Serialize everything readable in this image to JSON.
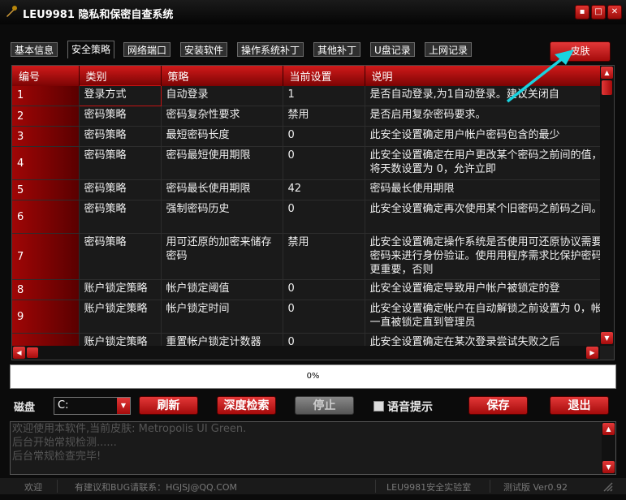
{
  "window": {
    "title": "LEU9981 隐私和保密自查系统",
    "min": "▪",
    "max": "□",
    "close": "✕"
  },
  "tabs": [
    "基本信息",
    "安全策略",
    "网络端口",
    "安装软件",
    "操作系统补丁",
    "其他补丁",
    "U盘记录",
    "上网记录"
  ],
  "active_tab": 1,
  "skin_button": "皮肤",
  "grid": {
    "columns": [
      "编号",
      "类别",
      "策略",
      "当前设置",
      "说明"
    ],
    "rows": [
      [
        "1",
        "登录方式",
        "自动登录",
        "1",
        "是否自动登录,为1自动登录。建议关闭自"
      ],
      [
        "2",
        "密码策略",
        "密码复杂性要求",
        "禁用",
        "是否启用复杂密码要求。"
      ],
      [
        "3",
        "密码策略",
        "最短密码长度",
        "0",
        "此安全设置确定用户帐户密码包含的最少"
      ],
      [
        "4",
        "密码策略",
        "密码最短使用期限",
        "0",
        "此安全设置确定在用户更改某个密码之前间的值，或者将天数设置为 0，允许立即"
      ],
      [
        "5",
        "密码策略",
        "密码最长使用期限",
        "42",
        "密码最长使用期限"
      ],
      [
        "6",
        "密码策略",
        "强制密码历史",
        "0",
        "此安全设置确定再次使用某个旧密码之前码之间。"
      ],
      [
        "7",
        "密码策略",
        "用可还原的加密来储存密码",
        "禁用",
        "此安全设置确定操作系统是否使用可还原协议需要用户密码来进行身份验证。使用用程序需求比保护密码信息更重要，否则"
      ],
      [
        "8",
        "账户锁定策略",
        "帐户锁定阈值",
        "0",
        "此安全设置确定导致用户帐户被锁定的登"
      ],
      [
        "9",
        "账户锁定策略",
        "帐户锁定时间",
        "0",
        "此安全设置确定帐户在自动解锁之前设置为 0，帐户将一直被锁定直到管理员"
      ],
      [
        "",
        "账户锁定策略",
        "重置帐户锁定计数器",
        "0",
        "此安全设置确定在某次登录尝试失败之后"
      ]
    ]
  },
  "progress": {
    "value": 0,
    "text": "0%"
  },
  "controls": {
    "disk_label": "磁盘",
    "disk_value": "C:",
    "refresh": "刷新",
    "deep_scan": "深度检索",
    "stop": "停止",
    "voice": "语音提示",
    "save": "保存",
    "exit": "退出"
  },
  "log": [
    "欢迎使用本软件,当前皮肤: Metropolis UI Green.",
    "后台开始常规检测......",
    "后台常规检查完毕!"
  ],
  "status": {
    "welcome": "欢迎",
    "contact": "有建议和BUG请联系：HGJSJ@QQ.COM",
    "lab": "LEU9981安全实验室",
    "version": "测试版 Ver0.92"
  },
  "colors": {
    "accent": "#c41414",
    "arrow": "#19d3e0"
  }
}
